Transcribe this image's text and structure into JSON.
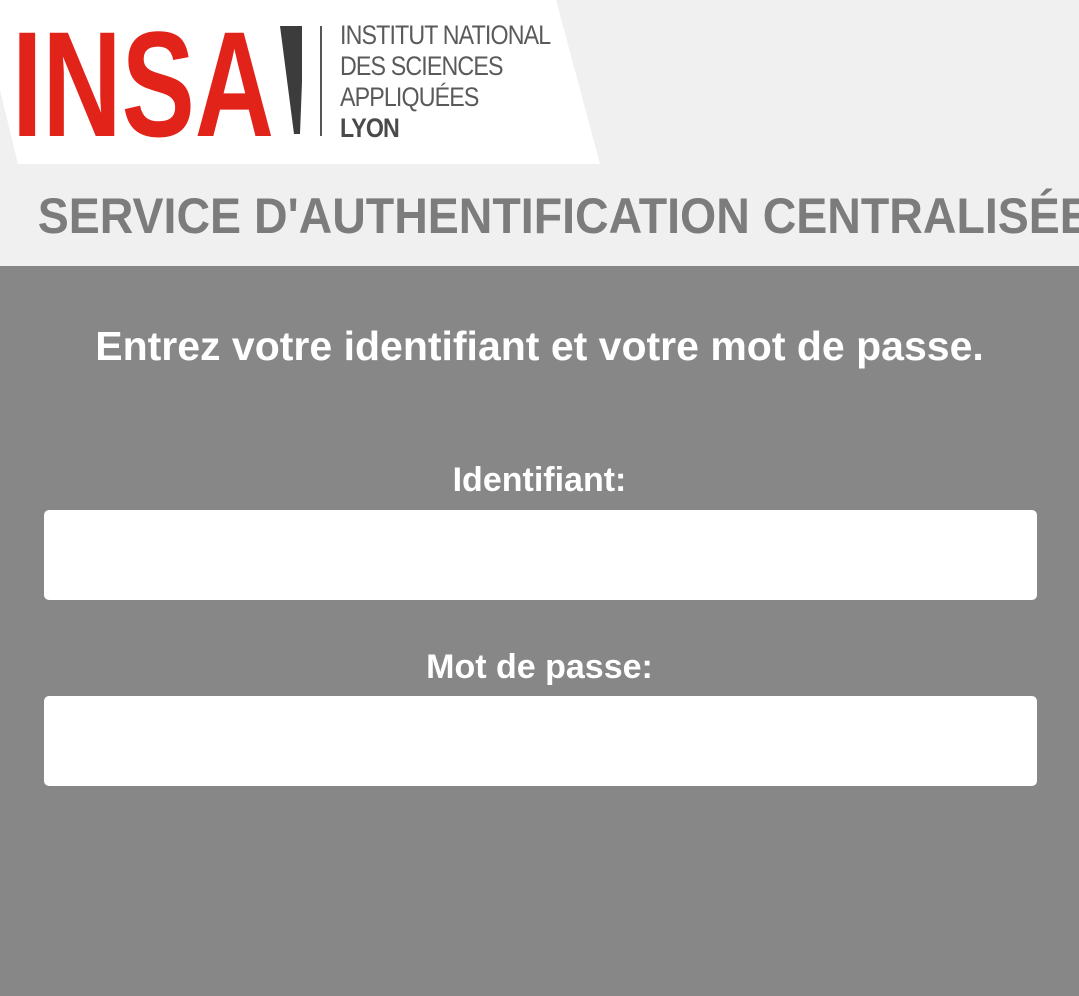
{
  "logo": {
    "brand": "INSA",
    "lines": [
      "INSTITUT NATIONAL",
      "DES SCIENCES",
      "APPLIQUÉES",
      "LYON"
    ],
    "brand_color": "#e2231a",
    "secondary_color": "#5a5a5a"
  },
  "header": {
    "title": "SERVICE D'AUTHENTIFICATION CENTRALISÉE",
    "background": "#f0f0f0",
    "title_color": "#7c7c7c"
  },
  "form": {
    "instructions": "Entrez votre identifiant et votre mot de passe.",
    "username_label": "Identifiant:",
    "username_value": "",
    "password_label": "Mot de passe:",
    "password_value": "",
    "background": "#878787"
  }
}
